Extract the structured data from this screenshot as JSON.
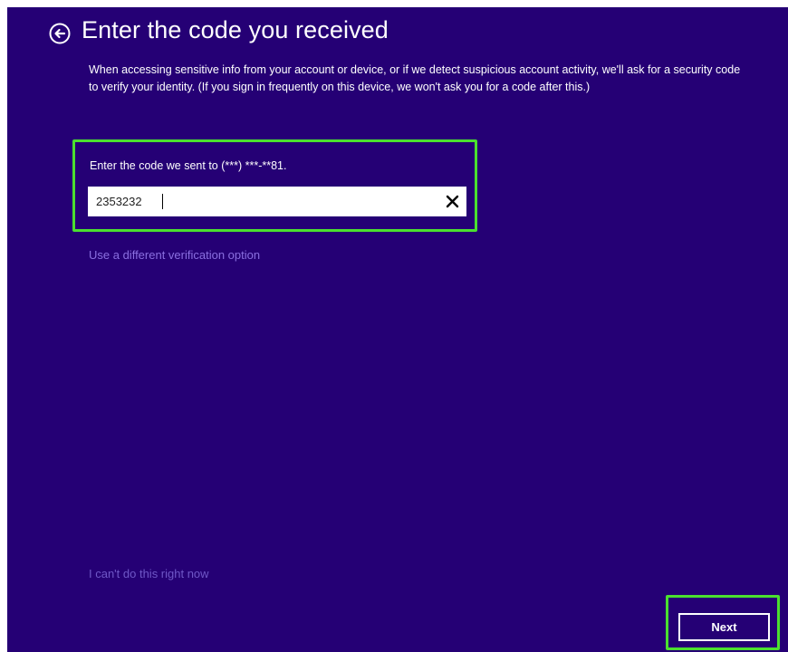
{
  "header": {
    "title": "Enter the code you received",
    "back_icon": "arrow-left-circle-icon"
  },
  "description": "When accessing sensitive info from your account or device, or if we detect suspicious account activity, we'll ask for a security code to verify your identity. (If you sign in frequently on this device, we won't ask you for a code after this.)",
  "code_entry": {
    "label": "Enter the code we sent to (***) ***-**81.",
    "value": "2353232",
    "clear_icon": "close-icon"
  },
  "links": {
    "different_option": "Use a different verification option",
    "cant_do_now": "I can't do this right now"
  },
  "footer": {
    "next_label": "Next"
  },
  "colors": {
    "background": "#250075",
    "highlight": "#4be02f",
    "link": "#8a6fe0",
    "text": "#ffffff"
  }
}
